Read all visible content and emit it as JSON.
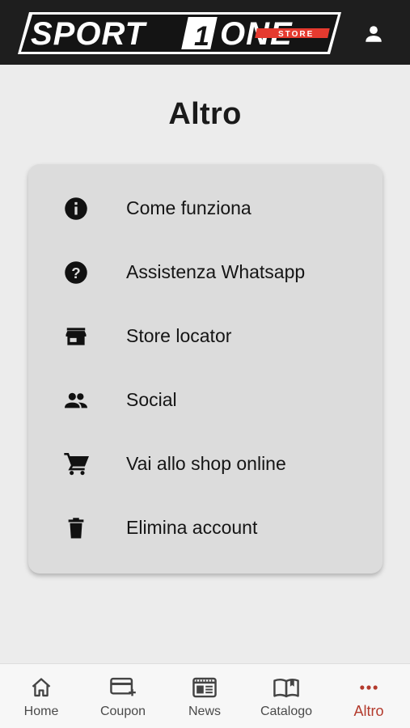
{
  "app": {
    "brand_primary": "SPORT",
    "brand_one": "ONE",
    "brand_sub": "STORE",
    "brand_color": "#e53a2f",
    "user_icon": "person-icon"
  },
  "page": {
    "title": "Altro"
  },
  "menu": {
    "items": [
      {
        "label": "Come funziona",
        "icon": "info-icon"
      },
      {
        "label": "Assistenza Whatsapp",
        "icon": "help-icon"
      },
      {
        "label": "Store locator",
        "icon": "store-icon"
      },
      {
        "label": "Social",
        "icon": "people-icon"
      },
      {
        "label": "Vai allo shop online",
        "icon": "cart-icon"
      },
      {
        "label": "Elimina account",
        "icon": "trash-icon"
      }
    ]
  },
  "bottom_nav": {
    "active": "Altro",
    "active_color": "#b33a2c",
    "items": [
      {
        "label": "Home",
        "icon": "home-icon"
      },
      {
        "label": "Coupon",
        "icon": "coupon-icon"
      },
      {
        "label": "News",
        "icon": "news-icon"
      },
      {
        "label": "Catalogo",
        "icon": "catalog-icon"
      },
      {
        "label": "Altro",
        "icon": "more-dots-icon"
      }
    ]
  }
}
